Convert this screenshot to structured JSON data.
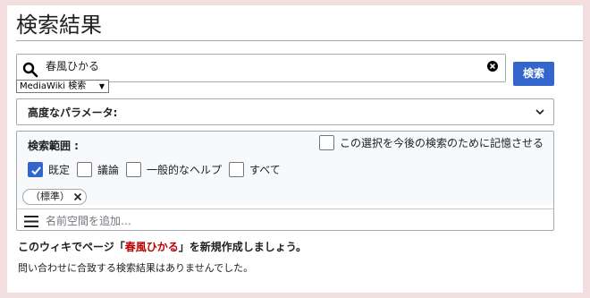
{
  "page_title": "検索結果",
  "search": {
    "value": "春風ひかる",
    "button_label": "検索",
    "profile_select": "MediaWiki 検索"
  },
  "advanced": {
    "label": "高度なパラメータ:"
  },
  "namespaces": {
    "title": "検索範囲 :",
    "remember_label": "この選択を今後の検索のために記憶させる",
    "options": [
      {
        "label": "既定",
        "checked": true
      },
      {
        "label": "議論",
        "checked": false
      },
      {
        "label": "一般的なヘルプ",
        "checked": false
      },
      {
        "label": "すべて",
        "checked": false
      }
    ],
    "chip_label": "（標準）",
    "add_placeholder": "名前空間を追加…"
  },
  "results": {
    "create_prefix": "このウィキでページ「",
    "create_link": "春風ひかる",
    "create_suffix": "」を新規作成しましょう。",
    "no_results": "問い合わせに合致する検索結果はありませんでした。"
  },
  "colors": {
    "accent": "#3366cc",
    "redlink": "#ba0000",
    "frame": "#f2dede"
  }
}
